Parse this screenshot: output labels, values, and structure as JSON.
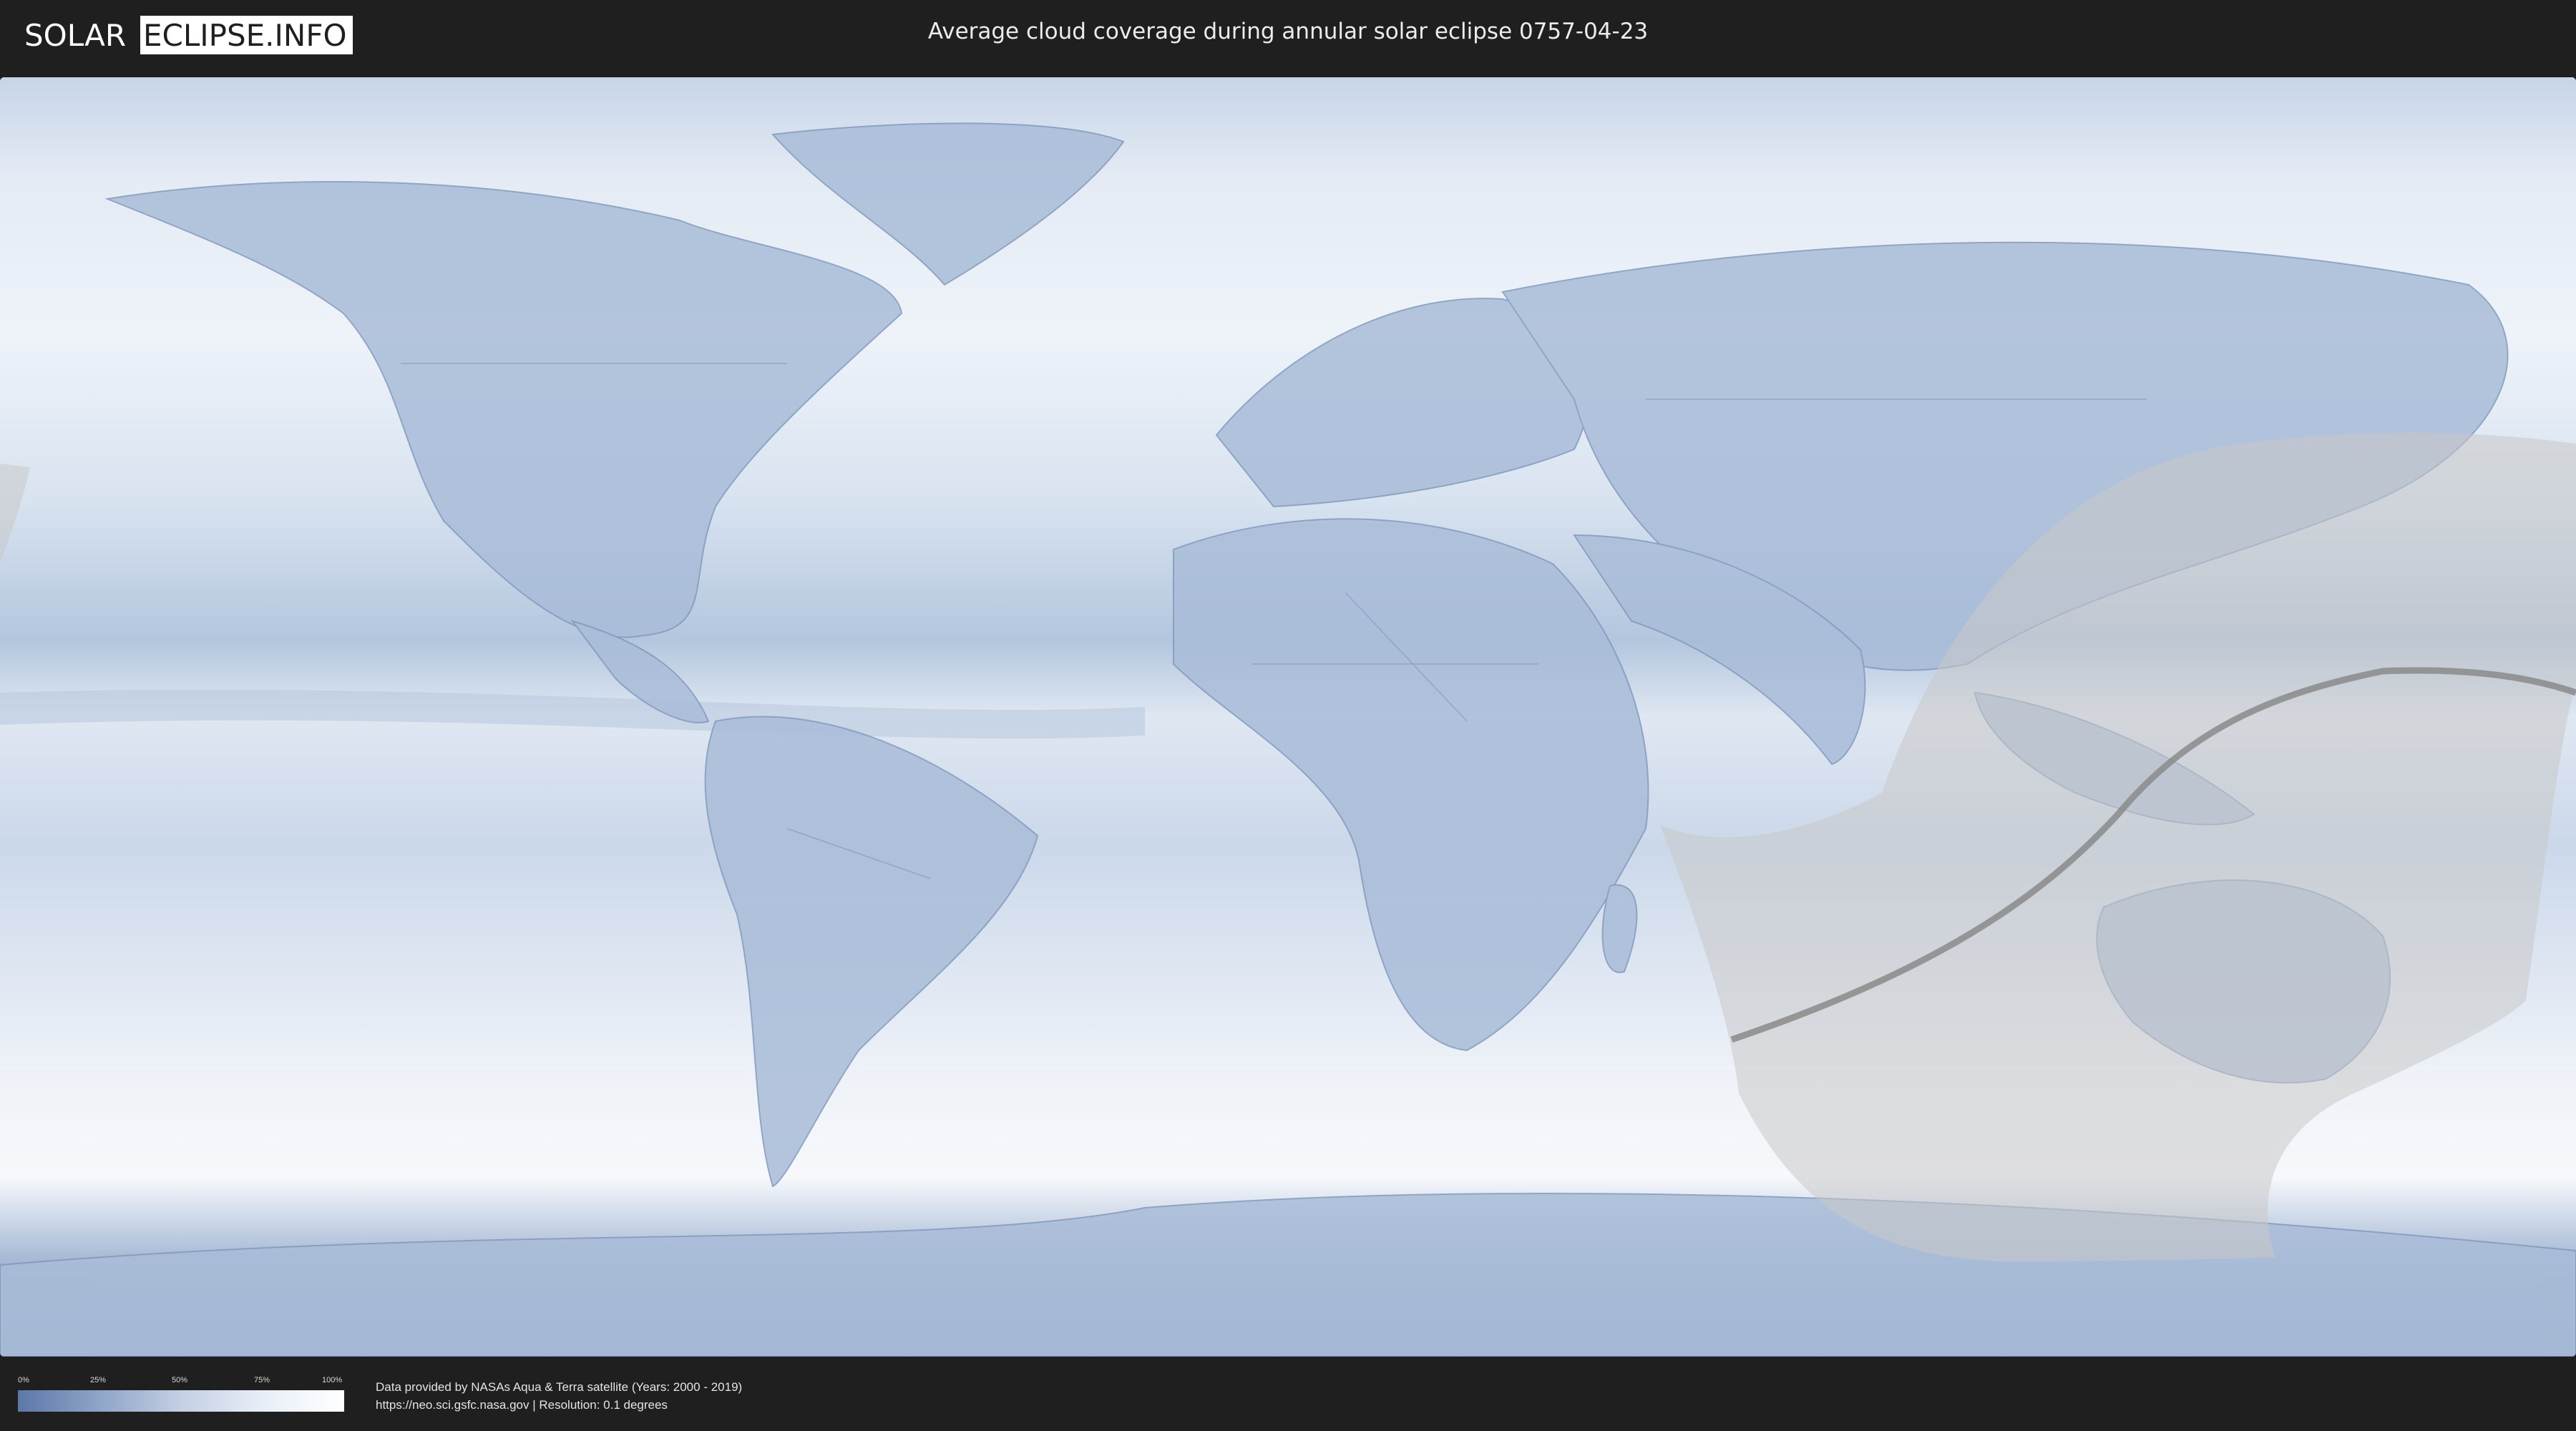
{
  "header": {
    "logo_left": "SOLAR",
    "logo_right": "ECLIPSE.INFO",
    "title": "Average cloud coverage during annular solar eclipse 0757-04-23"
  },
  "map": {
    "type": "equirectangular world cloud-coverage map",
    "eclipse_shadow_color": "#c9c9c9",
    "centerline_color": "#8a8a8a",
    "clear_color": "#5c77a8",
    "cloudy_color": "#ffffff"
  },
  "legend": {
    "ticks": [
      "0%",
      "25%",
      "50%",
      "75%",
      "100%"
    ],
    "min_color": "#5c77a8",
    "max_color": "#ffffff"
  },
  "footer": {
    "credit_line1": "Data provided by NASAs Aqua & Terra satellite (Years: 2000 - 2019)",
    "credit_line2": "https://neo.sci.gsfc.nasa.gov | Resolution: 0.1 degrees"
  }
}
